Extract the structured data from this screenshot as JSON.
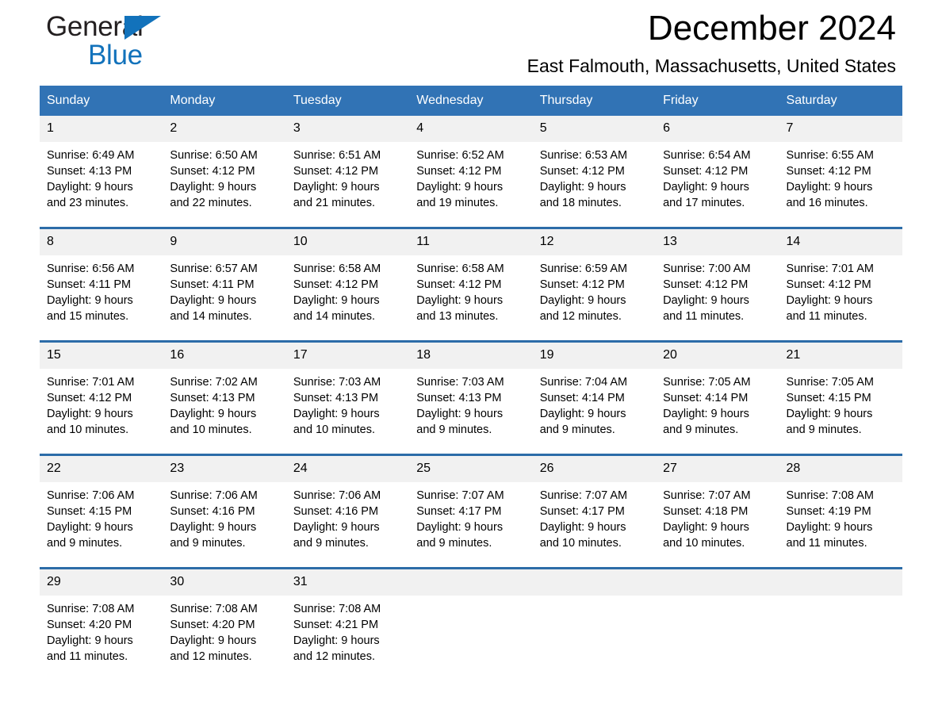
{
  "brand": {
    "name_part1": "General",
    "name_part2": "Blue",
    "triangle_color": "#1272bb",
    "text_color": "#231f20"
  },
  "header": {
    "title": "December 2024",
    "subtitle": "East Falmouth, Massachusetts, United States",
    "accent_color": "#3173b5",
    "daynum_band_color": "#f1f1f1"
  },
  "weekday_headers": [
    "Sunday",
    "Monday",
    "Tuesday",
    "Wednesday",
    "Thursday",
    "Friday",
    "Saturday"
  ],
  "labels": {
    "sunrise_prefix": "Sunrise:",
    "sunset_prefix": "Sunset:",
    "daylight_prefix": "Daylight:"
  },
  "weeks": [
    {
      "days": [
        {
          "date": "1",
          "sunrise": "Sunrise: 6:49 AM",
          "sunset": "Sunset: 4:13 PM",
          "daylight_l1": "Daylight: 9 hours",
          "daylight_l2": "and 23 minutes."
        },
        {
          "date": "2",
          "sunrise": "Sunrise: 6:50 AM",
          "sunset": "Sunset: 4:12 PM",
          "daylight_l1": "Daylight: 9 hours",
          "daylight_l2": "and 22 minutes."
        },
        {
          "date": "3",
          "sunrise": "Sunrise: 6:51 AM",
          "sunset": "Sunset: 4:12 PM",
          "daylight_l1": "Daylight: 9 hours",
          "daylight_l2": "and 21 minutes."
        },
        {
          "date": "4",
          "sunrise": "Sunrise: 6:52 AM",
          "sunset": "Sunset: 4:12 PM",
          "daylight_l1": "Daylight: 9 hours",
          "daylight_l2": "and 19 minutes."
        },
        {
          "date": "5",
          "sunrise": "Sunrise: 6:53 AM",
          "sunset": "Sunset: 4:12 PM",
          "daylight_l1": "Daylight: 9 hours",
          "daylight_l2": "and 18 minutes."
        },
        {
          "date": "6",
          "sunrise": "Sunrise: 6:54 AM",
          "sunset": "Sunset: 4:12 PM",
          "daylight_l1": "Daylight: 9 hours",
          "daylight_l2": "and 17 minutes."
        },
        {
          "date": "7",
          "sunrise": "Sunrise: 6:55 AM",
          "sunset": "Sunset: 4:12 PM",
          "daylight_l1": "Daylight: 9 hours",
          "daylight_l2": "and 16 minutes."
        }
      ]
    },
    {
      "days": [
        {
          "date": "8",
          "sunrise": "Sunrise: 6:56 AM",
          "sunset": "Sunset: 4:11 PM",
          "daylight_l1": "Daylight: 9 hours",
          "daylight_l2": "and 15 minutes."
        },
        {
          "date": "9",
          "sunrise": "Sunrise: 6:57 AM",
          "sunset": "Sunset: 4:11 PM",
          "daylight_l1": "Daylight: 9 hours",
          "daylight_l2": "and 14 minutes."
        },
        {
          "date": "10",
          "sunrise": "Sunrise: 6:58 AM",
          "sunset": "Sunset: 4:12 PM",
          "daylight_l1": "Daylight: 9 hours",
          "daylight_l2": "and 14 minutes."
        },
        {
          "date": "11",
          "sunrise": "Sunrise: 6:58 AM",
          "sunset": "Sunset: 4:12 PM",
          "daylight_l1": "Daylight: 9 hours",
          "daylight_l2": "and 13 minutes."
        },
        {
          "date": "12",
          "sunrise": "Sunrise: 6:59 AM",
          "sunset": "Sunset: 4:12 PM",
          "daylight_l1": "Daylight: 9 hours",
          "daylight_l2": "and 12 minutes."
        },
        {
          "date": "13",
          "sunrise": "Sunrise: 7:00 AM",
          "sunset": "Sunset: 4:12 PM",
          "daylight_l1": "Daylight: 9 hours",
          "daylight_l2": "and 11 minutes."
        },
        {
          "date": "14",
          "sunrise": "Sunrise: 7:01 AM",
          "sunset": "Sunset: 4:12 PM",
          "daylight_l1": "Daylight: 9 hours",
          "daylight_l2": "and 11 minutes."
        }
      ]
    },
    {
      "days": [
        {
          "date": "15",
          "sunrise": "Sunrise: 7:01 AM",
          "sunset": "Sunset: 4:12 PM",
          "daylight_l1": "Daylight: 9 hours",
          "daylight_l2": "and 10 minutes."
        },
        {
          "date": "16",
          "sunrise": "Sunrise: 7:02 AM",
          "sunset": "Sunset: 4:13 PM",
          "daylight_l1": "Daylight: 9 hours",
          "daylight_l2": "and 10 minutes."
        },
        {
          "date": "17",
          "sunrise": "Sunrise: 7:03 AM",
          "sunset": "Sunset: 4:13 PM",
          "daylight_l1": "Daylight: 9 hours",
          "daylight_l2": "and 10 minutes."
        },
        {
          "date": "18",
          "sunrise": "Sunrise: 7:03 AM",
          "sunset": "Sunset: 4:13 PM",
          "daylight_l1": "Daylight: 9 hours",
          "daylight_l2": "and 9 minutes."
        },
        {
          "date": "19",
          "sunrise": "Sunrise: 7:04 AM",
          "sunset": "Sunset: 4:14 PM",
          "daylight_l1": "Daylight: 9 hours",
          "daylight_l2": "and 9 minutes."
        },
        {
          "date": "20",
          "sunrise": "Sunrise: 7:05 AM",
          "sunset": "Sunset: 4:14 PM",
          "daylight_l1": "Daylight: 9 hours",
          "daylight_l2": "and 9 minutes."
        },
        {
          "date": "21",
          "sunrise": "Sunrise: 7:05 AM",
          "sunset": "Sunset: 4:15 PM",
          "daylight_l1": "Daylight: 9 hours",
          "daylight_l2": "and 9 minutes."
        }
      ]
    },
    {
      "days": [
        {
          "date": "22",
          "sunrise": "Sunrise: 7:06 AM",
          "sunset": "Sunset: 4:15 PM",
          "daylight_l1": "Daylight: 9 hours",
          "daylight_l2": "and 9 minutes."
        },
        {
          "date": "23",
          "sunrise": "Sunrise: 7:06 AM",
          "sunset": "Sunset: 4:16 PM",
          "daylight_l1": "Daylight: 9 hours",
          "daylight_l2": "and 9 minutes."
        },
        {
          "date": "24",
          "sunrise": "Sunrise: 7:06 AM",
          "sunset": "Sunset: 4:16 PM",
          "daylight_l1": "Daylight: 9 hours",
          "daylight_l2": "and 9 minutes."
        },
        {
          "date": "25",
          "sunrise": "Sunrise: 7:07 AM",
          "sunset": "Sunset: 4:17 PM",
          "daylight_l1": "Daylight: 9 hours",
          "daylight_l2": "and 9 minutes."
        },
        {
          "date": "26",
          "sunrise": "Sunrise: 7:07 AM",
          "sunset": "Sunset: 4:17 PM",
          "daylight_l1": "Daylight: 9 hours",
          "daylight_l2": "and 10 minutes."
        },
        {
          "date": "27",
          "sunrise": "Sunrise: 7:07 AM",
          "sunset": "Sunset: 4:18 PM",
          "daylight_l1": "Daylight: 9 hours",
          "daylight_l2": "and 10 minutes."
        },
        {
          "date": "28",
          "sunrise": "Sunrise: 7:08 AM",
          "sunset": "Sunset: 4:19 PM",
          "daylight_l1": "Daylight: 9 hours",
          "daylight_l2": "and 11 minutes."
        }
      ]
    },
    {
      "days": [
        {
          "date": "29",
          "sunrise": "Sunrise: 7:08 AM",
          "sunset": "Sunset: 4:20 PM",
          "daylight_l1": "Daylight: 9 hours",
          "daylight_l2": "and 11 minutes."
        },
        {
          "date": "30",
          "sunrise": "Sunrise: 7:08 AM",
          "sunset": "Sunset: 4:20 PM",
          "daylight_l1": "Daylight: 9 hours",
          "daylight_l2": "and 12 minutes."
        },
        {
          "date": "31",
          "sunrise": "Sunrise: 7:08 AM",
          "sunset": "Sunset: 4:21 PM",
          "daylight_l1": "Daylight: 9 hours",
          "daylight_l2": "and 12 minutes."
        },
        {
          "date": "",
          "sunrise": "",
          "sunset": "",
          "daylight_l1": "",
          "daylight_l2": ""
        },
        {
          "date": "",
          "sunrise": "",
          "sunset": "",
          "daylight_l1": "",
          "daylight_l2": ""
        },
        {
          "date": "",
          "sunrise": "",
          "sunset": "",
          "daylight_l1": "",
          "daylight_l2": ""
        },
        {
          "date": "",
          "sunrise": "",
          "sunset": "",
          "daylight_l1": "",
          "daylight_l2": ""
        }
      ]
    }
  ]
}
